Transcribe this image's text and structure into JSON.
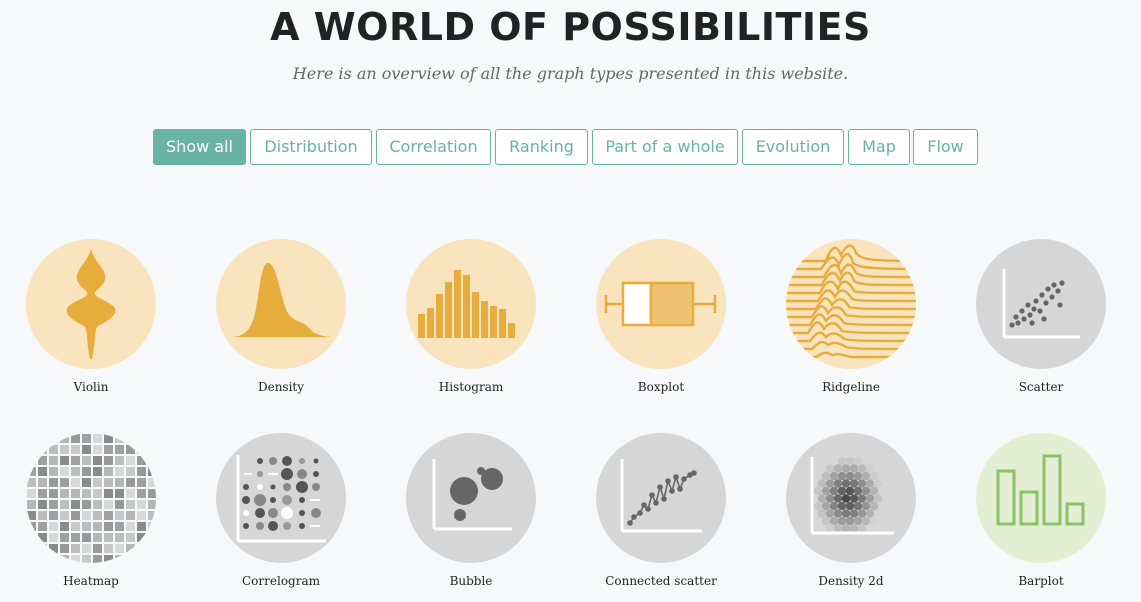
{
  "page": {
    "title": "A WORLD OF POSSIBILITIES",
    "subtitle": "Here is an overview of all the graph types presented in this website."
  },
  "filters": [
    {
      "label": "Show all",
      "active": true
    },
    {
      "label": "Distribution",
      "active": false
    },
    {
      "label": "Correlation",
      "active": false
    },
    {
      "label": "Ranking",
      "active": false
    },
    {
      "label": "Part of a whole",
      "active": false
    },
    {
      "label": "Evolution",
      "active": false
    },
    {
      "label": "Map",
      "active": false
    },
    {
      "label": "Flow",
      "active": false
    }
  ],
  "colors": {
    "accent": "#69b3a2",
    "distribution_bg": "#f9e4bd",
    "distribution_fg": "#e6ac3c",
    "correlation_bg": "#d6d6d6",
    "correlation_fg": "#666666",
    "ranking_bg": "#e3efd3",
    "ranking_fg": "#8fc16a"
  },
  "charts": [
    {
      "label": "Violin",
      "icon": "violin-thumbnail"
    },
    {
      "label": "Density",
      "icon": "density-thumbnail"
    },
    {
      "label": "Histogram",
      "icon": "histogram-thumbnail"
    },
    {
      "label": "Boxplot",
      "icon": "boxplot-thumbnail"
    },
    {
      "label": "Ridgeline",
      "icon": "ridgeline-thumbnail"
    },
    {
      "label": "Scatter",
      "icon": "scatter-thumbnail"
    },
    {
      "label": "Heatmap",
      "icon": "heatmap-thumbnail"
    },
    {
      "label": "Correlogram",
      "icon": "correlogram-thumbnail"
    },
    {
      "label": "Bubble",
      "icon": "bubble-thumbnail"
    },
    {
      "label": "Connected scatter",
      "icon": "connected-scatter-thumbnail"
    },
    {
      "label": "Density 2d",
      "icon": "density-2d-thumbnail"
    },
    {
      "label": "Barplot",
      "icon": "barplot-thumbnail"
    }
  ]
}
